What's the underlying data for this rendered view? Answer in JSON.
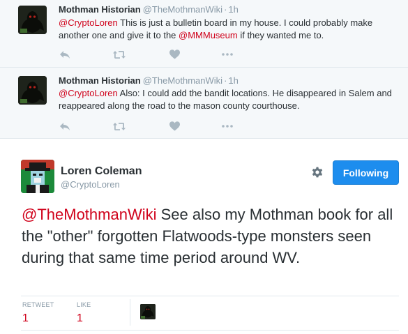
{
  "replies": [
    {
      "name": "Mothman Historian",
      "handle": "@TheMothmanWiki",
      "separator": "·",
      "time": "1h",
      "text_parts": {
        "mention1": "@CryptoLoren",
        "body1": " This is just a bulletin board in my house. I could probably make another one and give it to the ",
        "mention2": "@MMMuseum",
        "body2": " if they wanted me to."
      }
    },
    {
      "name": "Mothman Historian",
      "handle": "@TheMothmanWiki",
      "separator": "·",
      "time": "1h",
      "text_parts": {
        "mention1": "@CryptoLoren",
        "body1": " Also: I could add the bandit locations. He disappeared in Salem and reappeared along the road to the mason county courthouse."
      }
    }
  ],
  "reply_actions": {
    "reply_icon": "reply-icon",
    "retweet_icon": "retweet-icon",
    "like_icon": "heart-icon",
    "more_icon": "more-dots-icon"
  },
  "main_tweet": {
    "name": "Loren Coleman",
    "handle": "@CryptoLoren",
    "follow_label": "Following",
    "mention": "@TheMothmanWiki",
    "body": " See also my Mothman book for all the \"other\" forgotten Flatwoods-type monsters seen during that same time period around WV.",
    "retweet_label": "RETWEET",
    "retweet_count": "1",
    "like_label": "LIKE",
    "like_count": "1"
  },
  "colors": {
    "mention": "#d0021b",
    "follow_button": "#1d8dee",
    "reply_background": "#f5f8fa",
    "muted": "#8899a6"
  }
}
